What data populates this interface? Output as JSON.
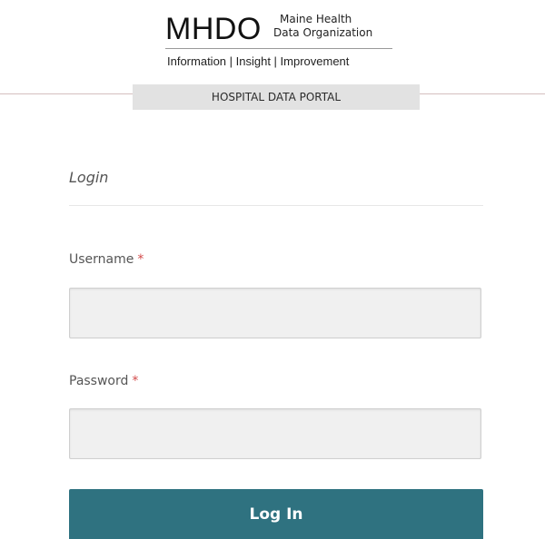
{
  "header": {
    "logo_main": "MHDO",
    "logo_side_line1": "Maine Health",
    "logo_side_line2": "Data Organization",
    "tagline": "Information | Insight | Improvement",
    "portal_label": "HOSPITAL DATA PORTAL"
  },
  "login": {
    "title": "Login",
    "username_label": "Username",
    "password_label": "Password",
    "required_marker": "*",
    "username_value": "",
    "password_value": "",
    "submit_label": "Log In"
  },
  "colors": {
    "primary_button": "#2f7280",
    "required_marker": "#d24a4a",
    "banner_background": "#e2e2e2",
    "input_background": "#f0f0f0"
  }
}
